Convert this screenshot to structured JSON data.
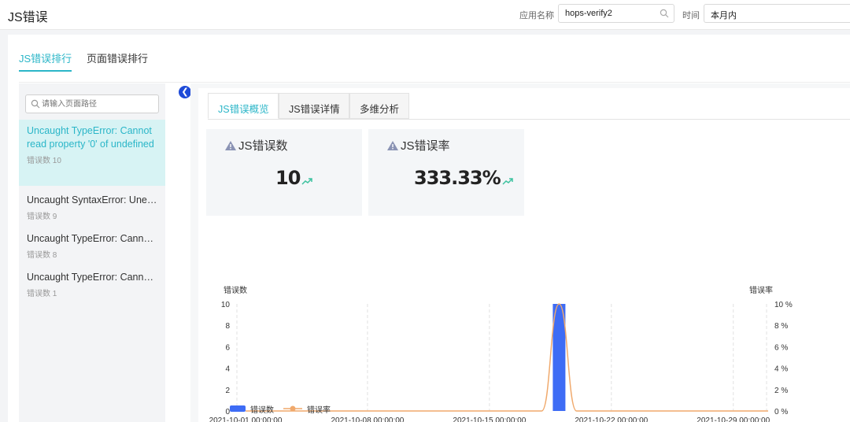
{
  "header": {
    "title": "JS错误",
    "app_label": "应用名称",
    "app_value": "hops-verify2",
    "time_label": "时间",
    "time_value": "本月内"
  },
  "main_tabs": [
    {
      "label": "JS错误排行",
      "active": true
    },
    {
      "label": "页面错误排行",
      "active": false
    }
  ],
  "search": {
    "placeholder": "请输入页面路径"
  },
  "errors": [
    {
      "message": "Uncaught TypeError: Cannot read property '0' of undefined",
      "count_text": "错误数 10",
      "active": true
    },
    {
      "message": "Uncaught SyntaxError: Unexpected token",
      "count_text": "错误数 9",
      "active": false
    },
    {
      "message": "Uncaught TypeError: Cannot read property",
      "count_text": "错误数 8",
      "active": false
    },
    {
      "message": "Uncaught TypeError: Cannot read property",
      "count_text": "错误数 1",
      "active": false
    }
  ],
  "sub_tabs": [
    {
      "label": "JS错误概览",
      "active": true
    },
    {
      "label": "JS错误详情",
      "active": false
    },
    {
      "label": "多维分析",
      "active": false
    }
  ],
  "kpis": [
    {
      "label": "JS错误数",
      "value": "10"
    },
    {
      "label": "JS错误率",
      "value": "333.33%"
    }
  ],
  "colors": {
    "accent": "#2bb6c8",
    "bar": "#3e6cf5",
    "line": "#f0a96c",
    "trend": "#3cc29f",
    "warn": "#8a93b4"
  },
  "chart_data": {
    "type": "bar",
    "y_left_label": "错误数",
    "y_right_label": "错误率",
    "y_left_ticks": [
      "0",
      "2",
      "4",
      "6",
      "8",
      "10"
    ],
    "y_right_ticks": [
      "0 %",
      "2 %",
      "4 %",
      "6 %",
      "8 %",
      "10 %"
    ],
    "ylim_left": [
      0,
      10
    ],
    "ylim_right": [
      0,
      10
    ],
    "x_tick_labels": [
      "2021-10-01 00:00:00",
      "2021-10-08 00:00:00",
      "2021-10-15 00:00:00",
      "2021-10-22 00:00:00",
      "2021-10-29 00:00:00"
    ],
    "x_range": [
      "2021-10-01",
      "2021-10-31"
    ],
    "series": [
      {
        "name": "错误数",
        "kind": "bar",
        "points": [
          {
            "x": "2021-10-19",
            "y": 10
          }
        ]
      },
      {
        "name": "错误率",
        "kind": "line",
        "points": [
          {
            "x": "2021-10-01",
            "y": 0
          },
          {
            "x": "2021-10-18",
            "y": 0
          },
          {
            "x": "2021-10-19",
            "y": 10
          },
          {
            "x": "2021-10-20",
            "y": 0
          },
          {
            "x": "2021-10-31",
            "y": 0
          }
        ]
      }
    ],
    "legend_position": "bottom-left",
    "grid": "vertical-dashed"
  }
}
